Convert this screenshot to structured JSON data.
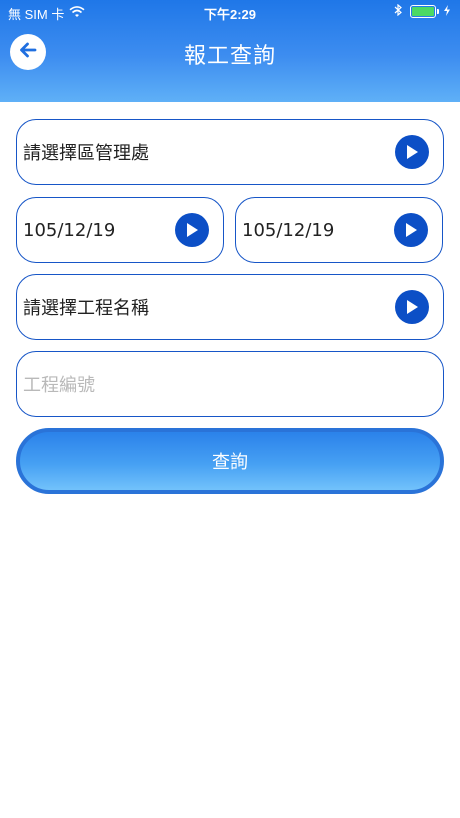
{
  "status_bar": {
    "carrier": "無 SIM 卡",
    "time": "下午2:29"
  },
  "header": {
    "title": "報工查詢",
    "back_icon": "arrow-left-icon"
  },
  "form": {
    "management_office": {
      "value": "請選擇區管理處",
      "icon": "play-icon"
    },
    "start_date": {
      "value": "105/12/19",
      "icon": "play-icon"
    },
    "end_date": {
      "value": "105/12/19",
      "icon": "play-icon"
    },
    "project_name": {
      "value": "請選擇工程名稱",
      "icon": "play-icon"
    },
    "project_number": {
      "value": "",
      "placeholder": "工程編號"
    },
    "query_label": "查詢"
  },
  "colors": {
    "header_gradient_top": "#1f77e8",
    "header_gradient_bottom": "#5fb0f7",
    "field_border": "#1756c7",
    "icon_fill": "#0c4fc6",
    "battery_fill": "#4cd964"
  }
}
